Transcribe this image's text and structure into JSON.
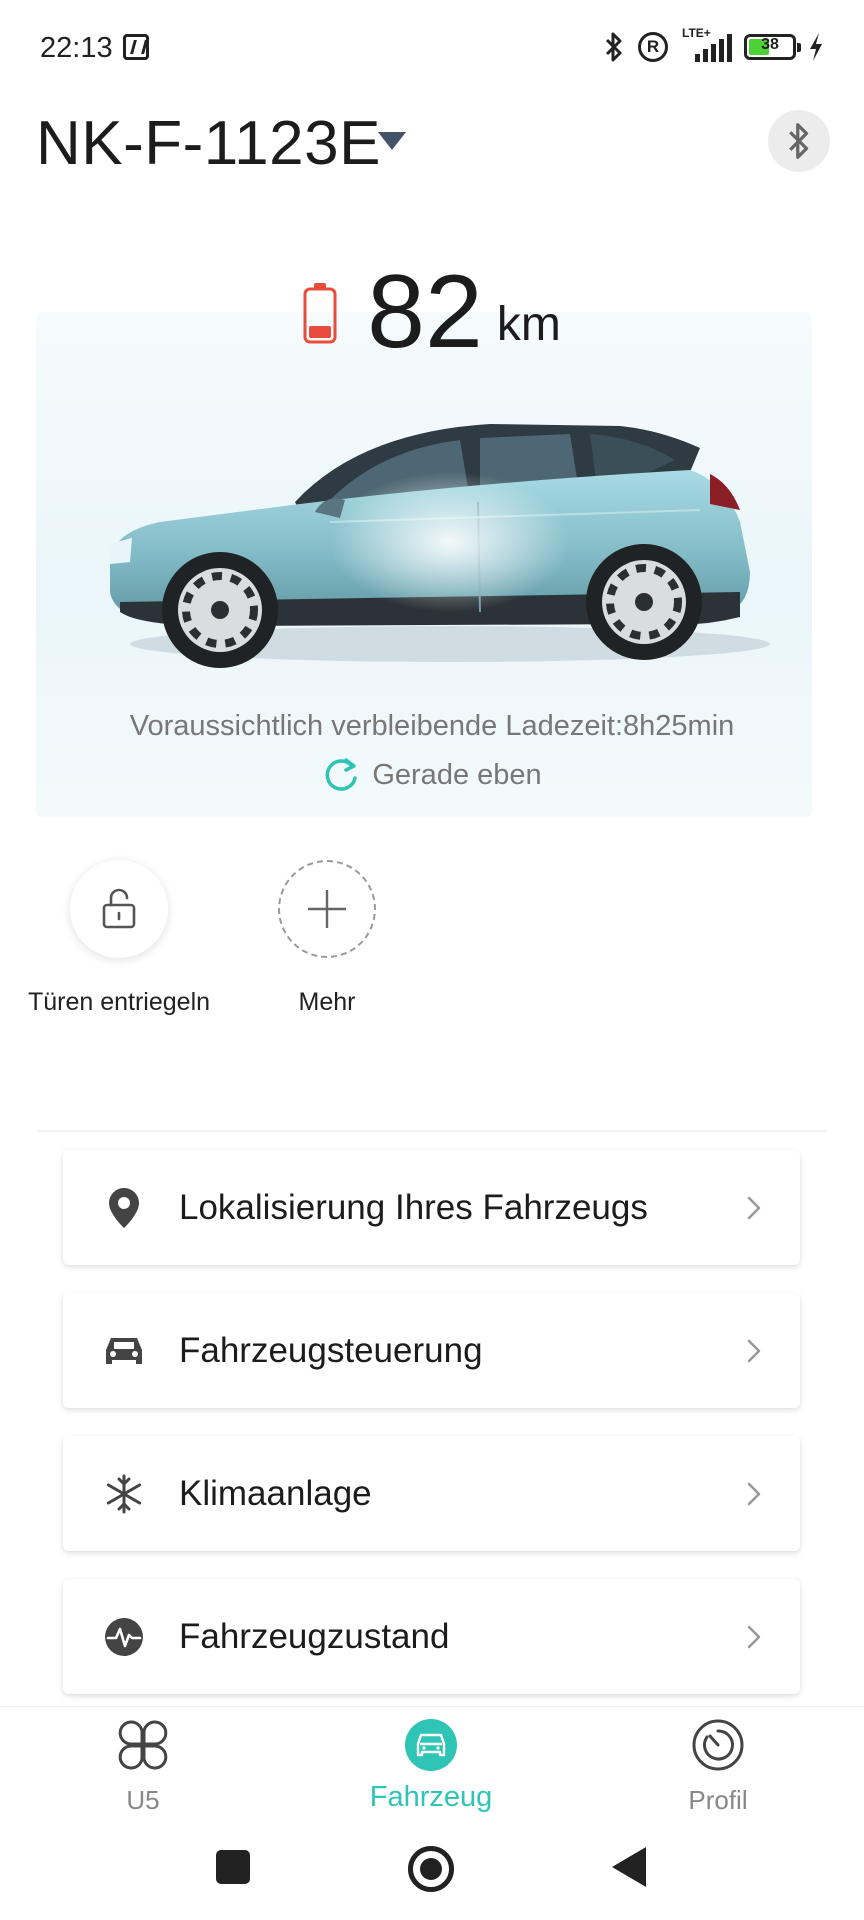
{
  "status_bar": {
    "time": "22:13",
    "network_type": "LTE+",
    "battery_percent": "38",
    "icons": [
      "nfc-icon",
      "bluetooth-icon",
      "registered-icon",
      "signal-icon",
      "battery-icon",
      "charging-bolt-icon"
    ]
  },
  "header": {
    "vehicle_plate": "NK-F-1123E",
    "icons": [
      "dropdown-caret-icon",
      "bluetooth-icon"
    ]
  },
  "vehicle_status": {
    "range_value": "82",
    "range_unit": "km",
    "battery_level": "low",
    "charge_time_text": "Voraussichtlich verbleibende Ladezeit:8h25min",
    "last_update_text": "Gerade eben"
  },
  "quick_actions": [
    {
      "label": "Türen entriegeln",
      "icon": "unlock-icon"
    },
    {
      "label": "Mehr",
      "icon": "plus-icon"
    }
  ],
  "menu": [
    {
      "label": "Lokalisierung Ihres Fahrzeugs",
      "icon": "location-pin-icon"
    },
    {
      "label": "Fahrzeugsteuerung",
      "icon": "car-icon"
    },
    {
      "label": "Klimaanlage",
      "icon": "snowflake-icon"
    },
    {
      "label": "Fahrzeugzustand",
      "icon": "heartbeat-icon"
    }
  ],
  "bottom_nav": [
    {
      "label": "U5",
      "icon": "clover-icon",
      "active": false
    },
    {
      "label": "Fahrzeug",
      "icon": "car-icon",
      "active": true
    },
    {
      "label": "Profil",
      "icon": "profile-dial-icon",
      "active": false
    }
  ],
  "colors": {
    "accent": "#2ec4b6",
    "battery_low": "#e84c3d",
    "car_body": "#8fc6d1",
    "text_primary": "#1c1c1c",
    "text_secondary": "#777777"
  }
}
